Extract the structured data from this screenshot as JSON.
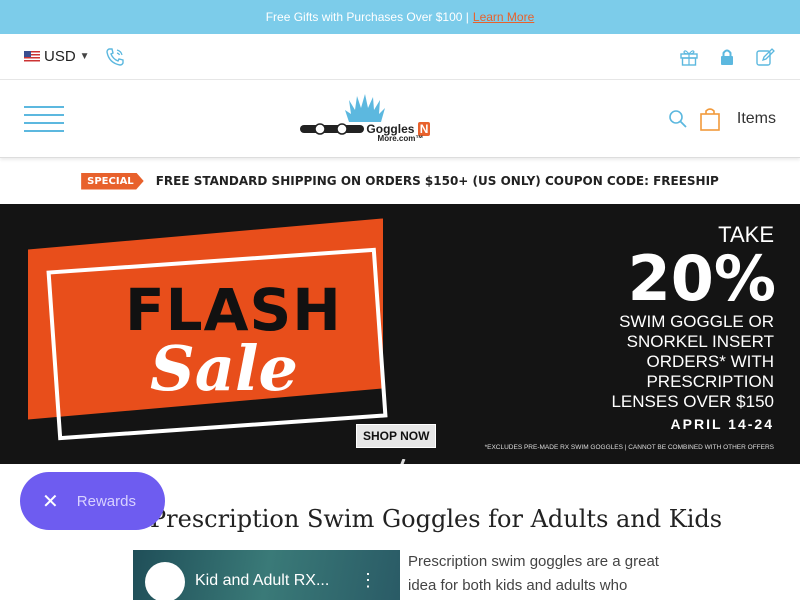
{
  "topbar": {
    "text": "Free Gifts with Purchases Over $100 |",
    "link": "Learn More"
  },
  "util": {
    "currency": "USD",
    "icons": [
      "flag-icon",
      "phone-icon",
      "gift-icon",
      "lock-icon",
      "edit-icon"
    ]
  },
  "nav": {
    "logo_text": "Goggles",
    "logo_n": "N",
    "logo_sub": "More.com™",
    "cart_label": "Items"
  },
  "promo": {
    "badge": "SPECIAL",
    "text": "FREE STANDARD SHIPPING ON ORDERS $150+ (US ONLY) COUPON CODE: FREESHIP"
  },
  "banner": {
    "flash": "FLASH",
    "sale": "Sale",
    "take": "TAKE",
    "percent": "20%",
    "description": "SWIM GOGGLE OR SNORKEL INSERT ORDERS* WITH PRESCRIPTION LENSES OVER $150",
    "dates": "APRIL 14-24",
    "cta": "SHOP NOW",
    "fineprint": "*EXCLUDES PRE-MADE RX SWIM GOGGLES | CANNOT BE COMBINED WITH OTHER OFFERS"
  },
  "rewards": {
    "close": "✕",
    "label": "Rewards"
  },
  "content": {
    "heading": "Prescription Swim Goggles for Adults and Kids",
    "video_title": "Kid and Adult RX...",
    "video_menu": "⋮",
    "paragraph": "Prescription swim goggles are a great idea for both kids and adults who"
  },
  "colors": {
    "accent": "#7cccea",
    "orange": "#e8612c",
    "rewards": "#6e5cf0"
  }
}
